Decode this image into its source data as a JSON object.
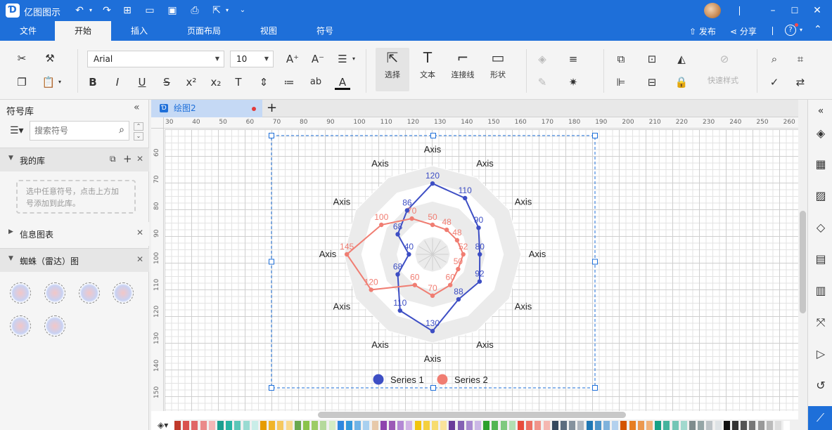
{
  "app": {
    "title": "亿图图示"
  },
  "menu": {
    "items": [
      "文件",
      "开始",
      "插入",
      "页面布局",
      "视图",
      "符号"
    ],
    "active": "开始",
    "publish": "发布",
    "share": "分享"
  },
  "ribbon": {
    "font_family": "Arial",
    "font_size": "10",
    "select_label": "选择",
    "text_label": "文本",
    "connector_label": "连接线",
    "shape_label": "形状",
    "quick_style_label": "快速样式"
  },
  "library": {
    "title": "符号库",
    "search_placeholder": "搜索符号",
    "my_library": "我的库",
    "my_library_hint": "选中任意符号，点击上方加号添加到此库。",
    "info_chart": "信息图表",
    "radar_section": "蜘蛛（雷达）图"
  },
  "document": {
    "tab_name": "绘图2"
  },
  "rulers": {
    "h_labels": [
      "30",
      "40",
      "50",
      "60",
      "70",
      "80",
      "90",
      "100",
      "110",
      "120",
      "130",
      "140",
      "150",
      "160",
      "170",
      "180",
      "190",
      "200",
      "210",
      "220",
      "230",
      "240",
      "250",
      "260"
    ],
    "v_labels": [
      "60",
      "70",
      "80",
      "90",
      "100",
      "110",
      "120",
      "130",
      "140",
      "150"
    ]
  },
  "chart_data": {
    "type": "radar",
    "axes": [
      "Axis",
      "Axis",
      "Axis",
      "Axis",
      "Axis",
      "Axis",
      "Axis",
      "Axis",
      "Axis",
      "Axis",
      "Axis",
      "Axis"
    ],
    "rmax": 150,
    "rings": 5,
    "series": [
      {
        "name": "Series 1",
        "color": "#3d4ec4",
        "values": [
          120,
          110,
          90,
          80,
          92,
          88,
          130,
          110,
          68,
          40,
          68,
          86
        ]
      },
      {
        "name": "Series 2",
        "color": "#f07d72",
        "values": [
          50,
          48,
          48,
          52,
          50,
          60,
          70,
          60,
          120,
          145,
          100,
          70
        ]
      }
    ],
    "legend": "bottom"
  },
  "colors": {
    "brand": "#1e6fd9",
    "selection": "#1e6fd9"
  },
  "palette": [
    "#c0392b",
    "#d9534f",
    "#e06666",
    "#ea8a8a",
    "#f4b6b6",
    "#1a9e8f",
    "#27b3a3",
    "#5bc6b8",
    "#9adbd2",
    "#c9ede8",
    "#e69b00",
    "#f0b429",
    "#f6c85f",
    "#f9d98c",
    "#6aa84f",
    "#8bc34a",
    "#9ccc65",
    "#b5d99c",
    "#d4ecc4",
    "#2e86de",
    "#3498db",
    "#6fb3e6",
    "#a9d0f0",
    "#e7c9a9",
    "#8e44ad",
    "#9b59b6",
    "#b388d4",
    "#d1b3e6",
    "#f1c40f",
    "#f4d03f",
    "#f7dc6f",
    "#fae39b",
    "#6a3d9a",
    "#8461b3",
    "#a98bd0",
    "#cbb7e6",
    "#2ca02c",
    "#52b552",
    "#7fc97f",
    "#b2dfb2",
    "#e74c3c",
    "#ec7063",
    "#f1948a",
    "#f5b7b1",
    "#34495e",
    "#5d6d7e",
    "#85929e",
    "#aeb6bf",
    "#1f77b4",
    "#4c94c9",
    "#7fb2dc",
    "#b3d1ee",
    "#d35400",
    "#e67e22",
    "#eb984e",
    "#f0b27a",
    "#16a085",
    "#45b39d",
    "#73c6b6",
    "#a2d9ce",
    "#7f8c8d",
    "#95a5a6",
    "#bdc3c7",
    "#dfe3e6",
    "#111111",
    "#333333",
    "#555555",
    "#777777",
    "#999999",
    "#bbbbbb",
    "#dddddd",
    "#ffffff"
  ]
}
